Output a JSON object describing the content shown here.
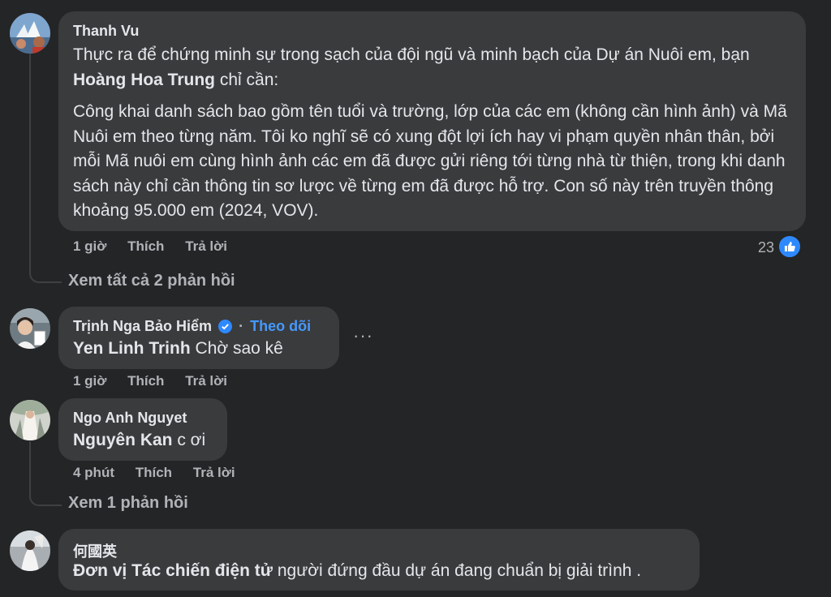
{
  "comments": [
    {
      "author": "Thanh Vu",
      "para1_pre": "Thực ra để chứng minh sự trong sạch của đội ngũ và minh bạch của Dự án Nuôi em, bạn ",
      "para1_mention": "Hoàng Hoa Trung",
      "para1_post": " chỉ cần:",
      "para2": "Công khai danh sách bao gồm tên tuổi và trường, lớp của các em (không cần hình ảnh) và Mã Nuôi em theo từng năm. Tôi ko nghĩ sẽ có xung đột lợi ích hay vi phạm quyền nhân thân, bởi mỗi Mã nuôi em cùng hình ảnh các em đã được gửi riêng tới từng nhà từ thiện, trong khi danh sách này chỉ cần thông tin sơ lược về từng em đã được hỗ trợ. Con số này trên truyền thông khoảng 95.000 em (2024, VOV).",
      "time": "1 giờ",
      "like_label": "Thích",
      "reply_label": "Trả lời",
      "reaction_count": "23",
      "replies_link": "Xem tất cả 2 phản hồi"
    },
    {
      "author": "Trịnh Nga Bảo Hiểm",
      "follow": "Theo dõi",
      "separator": "·",
      "mention": "Yen Linh Trinh",
      "text": " Chờ sao kê",
      "time": "1 giờ",
      "like_label": "Thích",
      "reply_label": "Trả lời",
      "more": "···"
    },
    {
      "author": "Ngo Anh Nguyet",
      "mention": "Nguyên Kan",
      "text": " c ơi",
      "time": "4 phút",
      "like_label": "Thích",
      "reply_label": "Trả lời",
      "replies_link": "Xem 1 phản hồi"
    },
    {
      "author": "何國英",
      "mention": "Đơn vị Tác chiến điện tử",
      "text": " người đứng đầu dự án đang chuẩn bị giải trình ."
    }
  ]
}
